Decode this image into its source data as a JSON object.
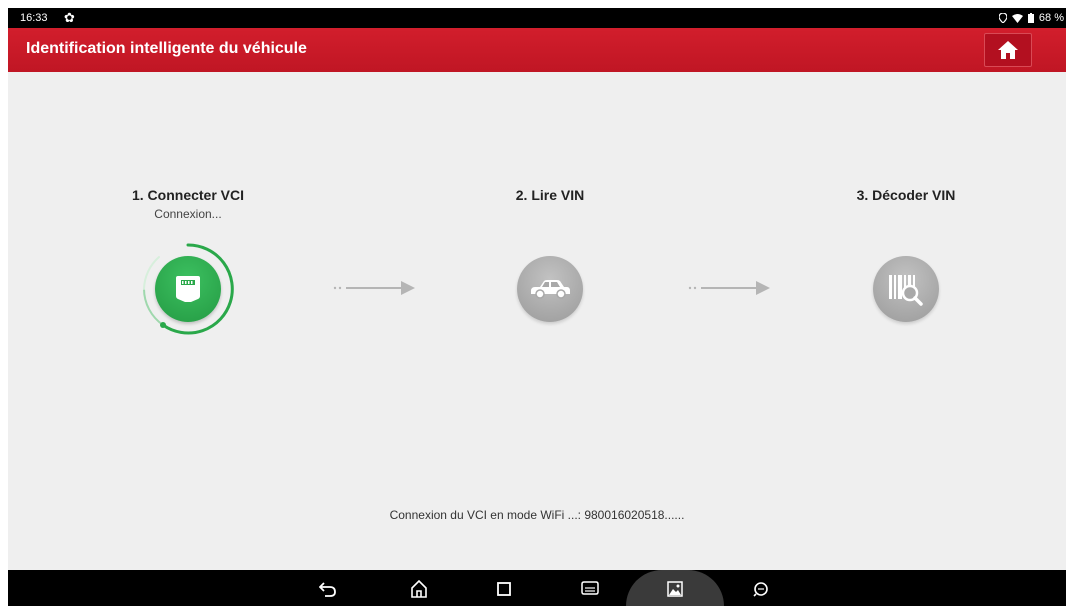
{
  "status_bar": {
    "time": "16:33",
    "battery": "68 %",
    "icons": [
      "gear-icon",
      "location-icon",
      "wifi-icon",
      "battery-icon"
    ]
  },
  "header": {
    "title": "Identification intelligente du véhicule",
    "home_icon": "home-icon"
  },
  "steps": [
    {
      "title": "1. Connecter VCI",
      "subtitle": "Connexion...",
      "icon": "vci-connector-icon",
      "state": "active",
      "color": "#2aa84a"
    },
    {
      "title": "2. Lire VIN",
      "icon": "car-icon",
      "state": "pending"
    },
    {
      "title": "3. Décoder VIN",
      "icon": "barcode-search-icon",
      "state": "pending"
    }
  ],
  "status_message": "Connexion du VCI en mode WiFi ...: 980016020518......",
  "nav_bar": {
    "buttons": [
      "back-icon",
      "home-icon",
      "recents-icon",
      "vci-icon",
      "screenshot-icon",
      "browser-icon"
    ]
  },
  "colors": {
    "header_red": "#c8192a",
    "active_green": "#2aa84a",
    "pending_grey": "#aaaaaa",
    "background": "#efefef"
  }
}
